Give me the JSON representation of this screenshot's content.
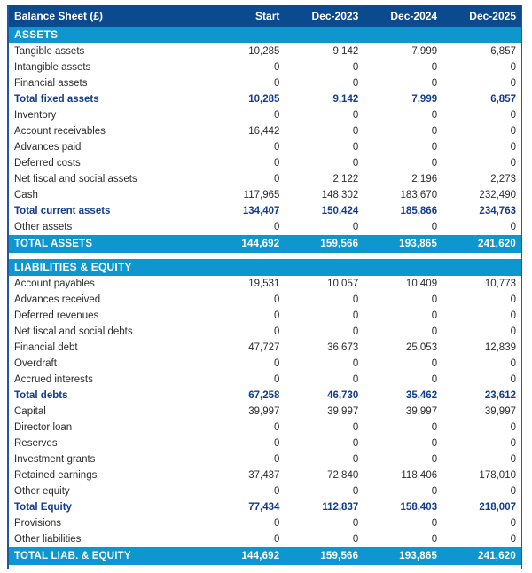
{
  "table": {
    "columns": [
      "Balance Sheet (£)",
      "Start",
      "Dec-2023",
      "Dec-2024",
      "Dec-2025"
    ],
    "sections": [
      {
        "band": "ASSETS",
        "rows": [
          {
            "label": "Tangible assets",
            "kind": "item",
            "values": [
              "10,285",
              "9,142",
              "7,999",
              "6,857"
            ]
          },
          {
            "label": "Intangible assets",
            "kind": "item",
            "values": [
              "0",
              "0",
              "0",
              "0"
            ]
          },
          {
            "label": "Financial assets",
            "kind": "item",
            "values": [
              "0",
              "0",
              "0",
              "0"
            ]
          },
          {
            "label": "Total fixed assets",
            "kind": "subtotal",
            "values": [
              "10,285",
              "9,142",
              "7,999",
              "6,857"
            ]
          },
          {
            "label": "Inventory",
            "kind": "item",
            "values": [
              "0",
              "0",
              "0",
              "0"
            ]
          },
          {
            "label": "Account receivables",
            "kind": "item",
            "values": [
              "16,442",
              "0",
              "0",
              "0"
            ]
          },
          {
            "label": "Advances paid",
            "kind": "item",
            "values": [
              "0",
              "0",
              "0",
              "0"
            ]
          },
          {
            "label": "Deferred costs",
            "kind": "item",
            "values": [
              "0",
              "0",
              "0",
              "0"
            ]
          },
          {
            "label": "Net fiscal and social assets",
            "kind": "item",
            "values": [
              "0",
              "2,122",
              "2,196",
              "2,273"
            ]
          },
          {
            "label": "Cash",
            "kind": "item",
            "values": [
              "117,965",
              "148,302",
              "183,670",
              "232,490"
            ]
          },
          {
            "label": "Total current assets",
            "kind": "subtotal",
            "values": [
              "134,407",
              "150,424",
              "185,866",
              "234,763"
            ]
          },
          {
            "label": "Other assets",
            "kind": "item",
            "values": [
              "0",
              "0",
              "0",
              "0"
            ]
          }
        ],
        "total": {
          "label": "TOTAL ASSETS",
          "values": [
            "144,692",
            "159,566",
            "193,865",
            "241,620"
          ]
        }
      },
      {
        "band": "LIABILITIES & EQUITY",
        "rows": [
          {
            "label": "Account payables",
            "kind": "item",
            "values": [
              "19,531",
              "10,057",
              "10,409",
              "10,773"
            ]
          },
          {
            "label": "Advances received",
            "kind": "item",
            "values": [
              "0",
              "0",
              "0",
              "0"
            ]
          },
          {
            "label": "Deferred revenues",
            "kind": "item",
            "values": [
              "0",
              "0",
              "0",
              "0"
            ]
          },
          {
            "label": "Net fiscal and social debts",
            "kind": "item",
            "values": [
              "0",
              "0",
              "0",
              "0"
            ]
          },
          {
            "label": "Financial debt",
            "kind": "item",
            "values": [
              "47,727",
              "36,673",
              "25,053",
              "12,839"
            ]
          },
          {
            "label": "Overdraft",
            "kind": "item",
            "values": [
              "0",
              "0",
              "0",
              "0"
            ]
          },
          {
            "label": "Accrued interests",
            "kind": "item",
            "values": [
              "0",
              "0",
              "0",
              "0"
            ]
          },
          {
            "label": "Total debts",
            "kind": "subtotal",
            "values": [
              "67,258",
              "46,730",
              "35,462",
              "23,612"
            ]
          },
          {
            "label": "Capital",
            "kind": "item",
            "values": [
              "39,997",
              "39,997",
              "39,997",
              "39,997"
            ]
          },
          {
            "label": "Director loan",
            "kind": "item",
            "values": [
              "0",
              "0",
              "0",
              "0"
            ]
          },
          {
            "label": "Reserves",
            "kind": "item",
            "values": [
              "0",
              "0",
              "0",
              "0"
            ]
          },
          {
            "label": "Investment grants",
            "kind": "item",
            "values": [
              "0",
              "0",
              "0",
              "0"
            ]
          },
          {
            "label": "Retained earnings",
            "kind": "item",
            "values": [
              "37,437",
              "72,840",
              "118,406",
              "178,010"
            ]
          },
          {
            "label": "Other equity",
            "kind": "item",
            "values": [
              "0",
              "0",
              "0",
              "0"
            ]
          },
          {
            "label": "Total Equity",
            "kind": "subtotal",
            "values": [
              "77,434",
              "112,837",
              "158,403",
              "218,007"
            ]
          },
          {
            "label": "Provisions",
            "kind": "item",
            "values": [
              "0",
              "0",
              "0",
              "0"
            ]
          },
          {
            "label": "Other liabilities",
            "kind": "item",
            "values": [
              "0",
              "0",
              "0",
              "0"
            ]
          }
        ],
        "total": {
          "label": "TOTAL LIAB. & EQUITY",
          "values": [
            "144,692",
            "159,566",
            "193,865",
            "241,620"
          ]
        }
      }
    ]
  },
  "colors": {
    "header_navy": "#0c4a8f",
    "band_cyan": "#0d97ce",
    "subtotal_text": "#123c8c",
    "item_text": "#2b2b2b",
    "border": "#1f56a5"
  }
}
